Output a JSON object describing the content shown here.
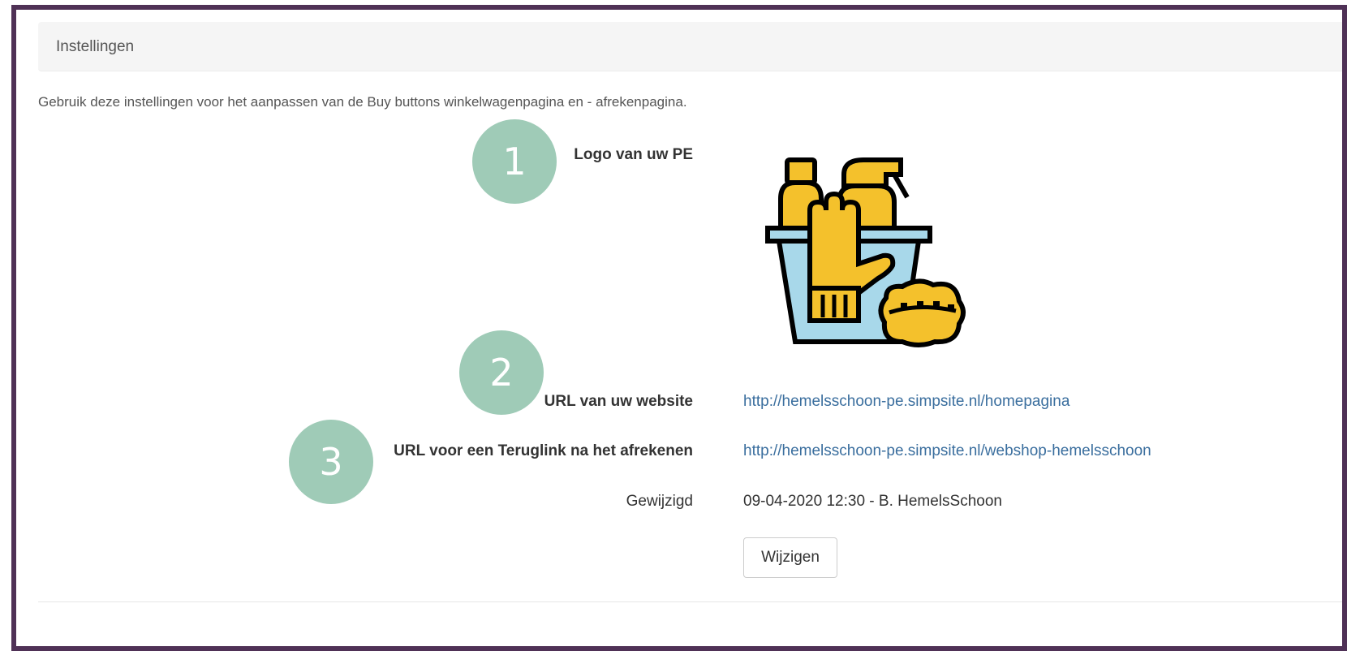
{
  "panel": {
    "title": "Instellingen",
    "intro": "Gebruik deze instellingen voor het aanpassen van de Buy buttons winkelwagenpagina en - afrekenpagina."
  },
  "fields": {
    "logo_label": "Logo van uw PE",
    "logo_icon": "cleaning-bucket-icon",
    "website_label": "URL van uw website",
    "website_value": "http://hemelsschoon-pe.simpsite.nl/homepagina",
    "returnlink_label": "URL voor een Teruglink na het afrekenen",
    "returnlink_value": "http://hemelsschoon-pe.simpsite.nl/webshop-hemelsschoon",
    "modified_label": "Gewijzigd",
    "modified_value": "09-04-2020 12:30 - B. HemelsSchoon"
  },
  "actions": {
    "edit_label": "Wijzigen"
  },
  "badges": [
    "1",
    "2",
    "3"
  ],
  "colors": {
    "frame": "#4f3156",
    "badge": "#9fcbb7",
    "link": "#3a6e9e",
    "logo_yellow": "#f4c12c",
    "logo_blue": "#a8d8ea"
  }
}
